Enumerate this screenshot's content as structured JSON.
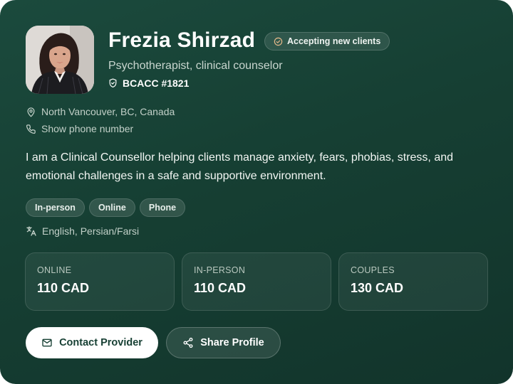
{
  "profile": {
    "name": "Frezia Shirzad",
    "status_badge": "Accepting new clients",
    "title": "Psychotherapist, clinical counselor",
    "license": "BCACC #1821",
    "location": "North Vancouver, BC, Canada",
    "phone_link": "Show phone number",
    "bio": "I am a Clinical Counsellor helping clients manage anxiety, fears, phobias, stress, and emotional challenges in a safe and supportive environment.",
    "session_types": [
      "In-person",
      "Online",
      "Phone"
    ],
    "languages": "English, Persian/Farsi"
  },
  "pricing": [
    {
      "label": "ONLINE",
      "value": "110 CAD"
    },
    {
      "label": "IN-PERSON",
      "value": "110 CAD"
    },
    {
      "label": "COUPLES",
      "value": "130 CAD"
    }
  ],
  "actions": {
    "contact_label": "Contact Provider",
    "share_label": "Share Profile"
  },
  "icons": {
    "status": "check-circle-icon",
    "license": "shield-check-icon",
    "location": "map-pin-icon",
    "phone": "phone-icon",
    "languages": "translate-icon",
    "contact": "mail-icon",
    "share": "share-icon"
  },
  "colors": {
    "card_background": "#163f33",
    "primary_button": "#ffffff",
    "accent_text": "#163f33"
  }
}
